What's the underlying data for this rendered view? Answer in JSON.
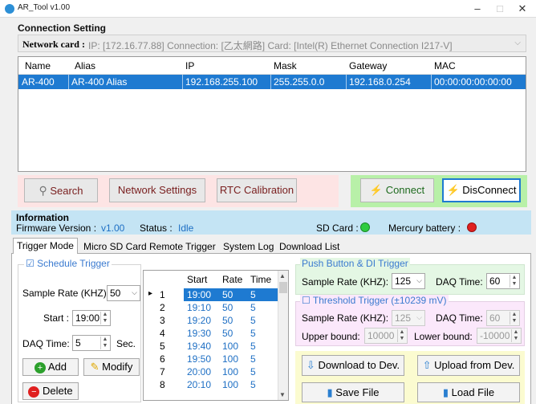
{
  "window": {
    "title": "AR_Tool v1.00",
    "min": "–",
    "max": "□",
    "close": "✕"
  },
  "connection": {
    "header": "Connection Setting",
    "network_card_label": "Network card :",
    "network_card_value": "IP: [172.16.77.88] Connection: [乙太網路] Card: [Intel(R) Ethernet Connection I217-V]",
    "columns": [
      "Name",
      "Alias",
      "IP",
      "Mask",
      "Gateway",
      "MAC"
    ],
    "rows": [
      [
        "AR-400",
        "AR-400 Alias",
        "192.168.255.100",
        "255.255.0.0",
        "192.168.0.254",
        "00:00:00:00:00:00"
      ]
    ]
  },
  "buttons": {
    "search": "Search",
    "network_settings": "Network Settings",
    "rtc_calibration": "RTC Calibration",
    "connect": "Connect",
    "disconnect": "DisConnect"
  },
  "info": {
    "header": "Information",
    "firmware_label": "Firmware Version :",
    "firmware_value": "v1.00",
    "status_label": "Status :",
    "status_value": "Idle",
    "sdcard_label": "SD Card :",
    "battery_label": "Mercury battery :",
    "sdcard_color": "#2ecc40",
    "battery_color": "#e02020"
  },
  "tabs": [
    "Trigger Mode",
    "Micro SD Card",
    "Remote Trigger",
    "System Log",
    "Download List"
  ],
  "schedule": {
    "title": "Schedule Trigger",
    "checkbox": "☑",
    "sample_rate_label": "Sample Rate (KHZ):",
    "sample_rate_value": "50",
    "start_label": "Start :",
    "start_value": "19:00",
    "daq_label": "DAQ Time:",
    "daq_value": "5",
    "daq_unit": "Sec.",
    "add": "Add",
    "modify": "Modify",
    "delete": "Delete"
  },
  "schedule_table": {
    "columns": [
      "Start",
      "Rate",
      "Time"
    ],
    "rows": [
      [
        "1",
        "19:00",
        "50",
        "5"
      ],
      [
        "2",
        "19:10",
        "50",
        "5"
      ],
      [
        "3",
        "19:20",
        "50",
        "5"
      ],
      [
        "4",
        "19:30",
        "50",
        "5"
      ],
      [
        "5",
        "19:40",
        "100",
        "5"
      ],
      [
        "6",
        "19:50",
        "100",
        "5"
      ],
      [
        "7",
        "20:00",
        "100",
        "5"
      ],
      [
        "8",
        "20:10",
        "100",
        "5"
      ]
    ],
    "selected_marker": "▸"
  },
  "push": {
    "title": "Push Button & DI Trigger",
    "sample_rate_label": "Sample Rate (KHZ):",
    "sample_rate_value": "125",
    "daq_label": "DAQ Time:",
    "daq_value": "60"
  },
  "threshold": {
    "title": "Threshold Trigger (±10239 mV)",
    "checkbox": "☐",
    "sample_rate_label": "Sample Rate (KHZ):",
    "sample_rate_value": "125",
    "daq_label": "DAQ Time:",
    "daq_value": "60",
    "upper_label": "Upper bound:",
    "upper_value": "10000",
    "lower_label": "Lower bound:",
    "lower_value": "-10000"
  },
  "file_buttons": {
    "download": "Download to Dev.",
    "upload": "Upload from Dev.",
    "save": "Save File",
    "load": "Load File"
  }
}
